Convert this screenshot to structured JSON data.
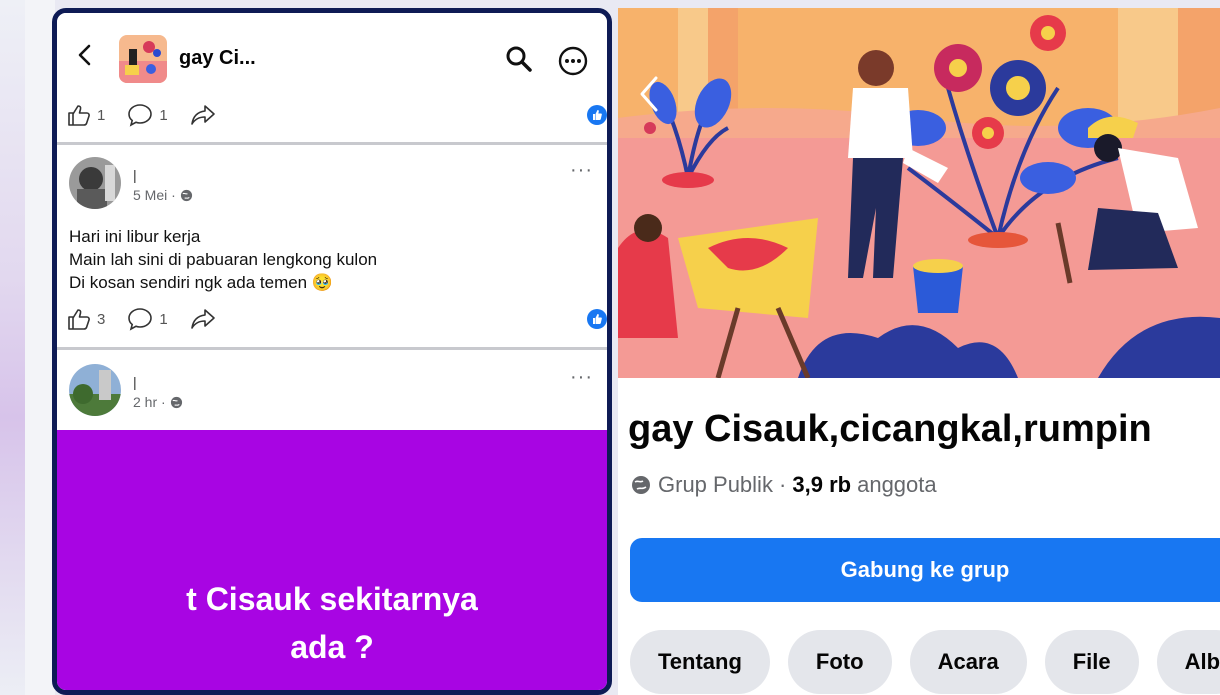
{
  "left": {
    "header": {
      "title": "gay Ci..."
    },
    "top_actions": {
      "likes": "1",
      "comments": "1"
    },
    "post1": {
      "author": "|",
      "time": "5 Mei ·",
      "lines": [
        "Hari ini libur kerja",
        "Main lah sini di pabuaran lengkong kulon",
        "Di kosan sendiri ngk ada temen 🥹"
      ],
      "likes": "3",
      "comments": "1"
    },
    "post2": {
      "author": "|",
      "time": "2 hr ·"
    },
    "purple_post": {
      "line1": "t Cisauk sekitarnya",
      "line2": "ada ?",
      "bg": "#a805e3"
    }
  },
  "right": {
    "group_name": "gay Cisauk,cicangkal,rumpin",
    "privacy": "Grup Publik ·",
    "members_count": "3,9 rb",
    "members_label": "anggota",
    "join_label": "Gabung ke grup",
    "tabs": [
      "Tentang",
      "Foto",
      "Acara",
      "File",
      "Alb"
    ],
    "accent": "#1877f2"
  }
}
